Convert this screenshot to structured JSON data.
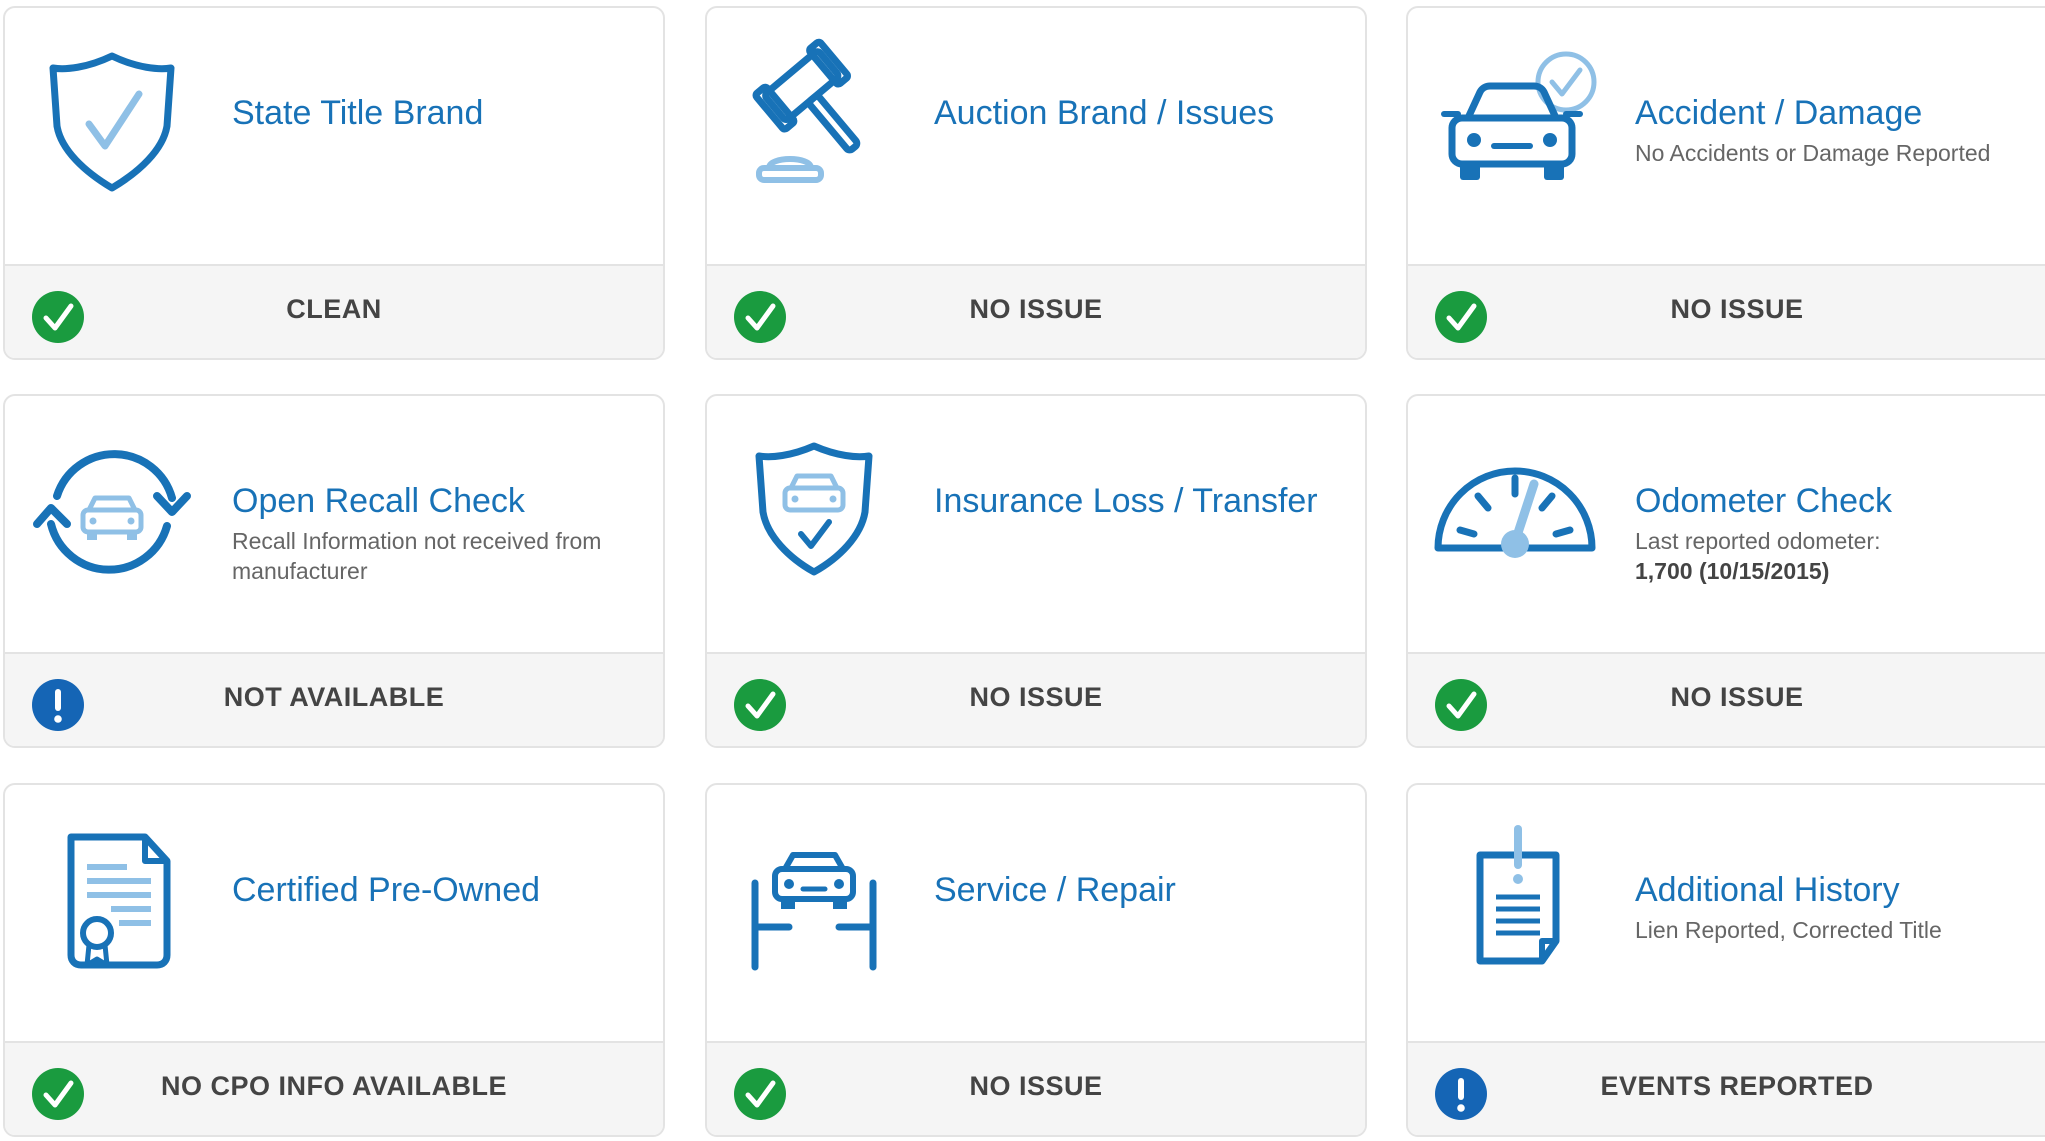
{
  "colors": {
    "brand_blue": "#1872b7",
    "light_blue": "#8fc0e6",
    "ok_green": "#1a9b3f",
    "info_blue": "#1565b5"
  },
  "cards": [
    {
      "title": "State Title Brand",
      "sub1": "",
      "sub2": "",
      "status": "CLEAN",
      "status_icon": "check-circle-icon"
    },
    {
      "title": "Auction Brand / Issues",
      "sub1": "",
      "sub2": "",
      "status": "NO ISSUE",
      "status_icon": "check-circle-icon"
    },
    {
      "title": "Accident / Damage",
      "sub1": "No Accidents or Damage Reported",
      "sub2": "",
      "status": "NO ISSUE",
      "status_icon": "check-circle-icon"
    },
    {
      "title": "Open Recall Check",
      "sub1": "Recall Information not received from manufacturer",
      "sub2": "",
      "status": "NOT AVAILABLE",
      "status_icon": "alert-circle-icon"
    },
    {
      "title": "Insurance Loss / Transfer",
      "sub1": "",
      "sub2": "",
      "status": "NO ISSUE",
      "status_icon": "check-circle-icon"
    },
    {
      "title": "Odometer Check",
      "sub1": "Last reported odometer:",
      "sub2": "1,700 (10/15/2015)",
      "status": "NO ISSUE",
      "status_icon": "check-circle-icon"
    },
    {
      "title": "Certified Pre-Owned",
      "sub1": "",
      "sub2": "",
      "status": "NO CPO INFO AVAILABLE",
      "status_icon": "check-circle-icon"
    },
    {
      "title": "Service / Repair",
      "sub1": "",
      "sub2": "",
      "status": "NO ISSUE",
      "status_icon": "check-circle-icon"
    },
    {
      "title": "Additional History",
      "sub1": "Lien Reported, Corrected Title",
      "sub2": "",
      "status": "EVENTS REPORTED",
      "status_icon": "alert-circle-icon"
    }
  ]
}
